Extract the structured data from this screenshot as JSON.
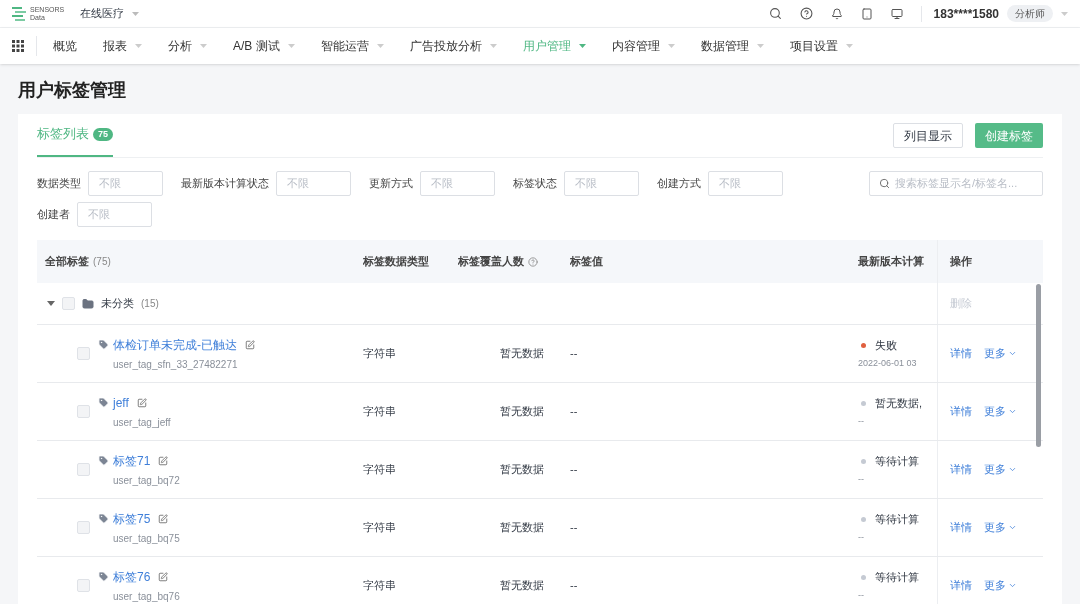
{
  "header": {
    "logo_text": [
      "SENSORS",
      "Data"
    ],
    "project": "在线医疗",
    "user": "183****1580",
    "role": "分析师"
  },
  "nav": [
    {
      "label": "概览",
      "selected": false,
      "has_menu": false
    },
    {
      "label": "报表",
      "selected": false,
      "has_menu": true
    },
    {
      "label": "分析",
      "selected": false,
      "has_menu": true
    },
    {
      "label": "A/B 测试",
      "selected": false,
      "has_menu": true
    },
    {
      "label": "智能运营",
      "selected": false,
      "has_menu": true
    },
    {
      "label": "广告投放分析",
      "selected": false,
      "has_menu": true
    },
    {
      "label": "用户管理",
      "selected": true,
      "has_menu": true
    },
    {
      "label": "内容管理",
      "selected": false,
      "has_menu": true
    },
    {
      "label": "数据管理",
      "selected": false,
      "has_menu": true
    },
    {
      "label": "项目设置",
      "selected": false,
      "has_menu": true
    }
  ],
  "page_title": "用户标签管理",
  "tabs": [
    {
      "label": "标签列表",
      "count": "75",
      "selected": true
    }
  ],
  "buttons": {
    "columns": "列目显示",
    "create": "创建标签"
  },
  "filters": [
    {
      "label": "数据类型",
      "placeholder": "不限"
    },
    {
      "label": "最新版本计算状态",
      "placeholder": "不限"
    },
    {
      "label": "更新方式",
      "placeholder": "不限"
    },
    {
      "label": "标签状态",
      "placeholder": "不限"
    },
    {
      "label": "创建方式",
      "placeholder": "不限"
    },
    {
      "label": "创建者",
      "placeholder": "不限"
    }
  ],
  "search": {
    "placeholder": "搜索标签显示名/标签名..."
  },
  "table": {
    "columns": [
      {
        "label": "全部标签",
        "count": "(75)"
      },
      {
        "label": "标签数据类型"
      },
      {
        "label": "标签覆盖人数",
        "help": true
      },
      {
        "label": "标签值"
      },
      {
        "label": "最新版本计算"
      },
      {
        "label": "操作"
      }
    ],
    "group": {
      "name": "未分类",
      "count": "(15)",
      "expanded": true,
      "checked": false,
      "action": "删除"
    },
    "rows": [
      {
        "name": "体检订单未完成-已触达",
        "key": "user_tag_sfn_33_27482271",
        "type": "字符串",
        "coverage": "暂无数据",
        "value": "--",
        "status": "失败",
        "color": "#e0603f",
        "time": "2022-06-01 03",
        "checked": false,
        "detail": "详情",
        "more": "更多"
      },
      {
        "name": "jeff",
        "key": "user_tag_jeff",
        "type": "字符串",
        "coverage": "暂无数据",
        "value": "--",
        "status": "暂无数据,",
        "color": "#c5cad3",
        "time": "--",
        "checked": false,
        "detail": "详情",
        "more": "更多"
      },
      {
        "name": "标签71",
        "key": "user_tag_bq72",
        "type": "字符串",
        "coverage": "暂无数据",
        "value": "--",
        "status": "等待计算",
        "color": "#c5cad3",
        "time": "--",
        "checked": false,
        "detail": "详情",
        "more": "更多"
      },
      {
        "name": "标签75",
        "key": "user_tag_bq75",
        "type": "字符串",
        "coverage": "暂无数据",
        "value": "--",
        "status": "等待计算",
        "color": "#c5cad3",
        "time": "--",
        "checked": false,
        "detail": "详情",
        "more": "更多"
      },
      {
        "name": "标签76",
        "key": "user_tag_bq76",
        "type": "字符串",
        "coverage": "暂无数据",
        "value": "--",
        "status": "等待计算",
        "color": "#c5cad3",
        "time": "--",
        "checked": false,
        "detail": "详情",
        "more": "更多"
      }
    ]
  }
}
